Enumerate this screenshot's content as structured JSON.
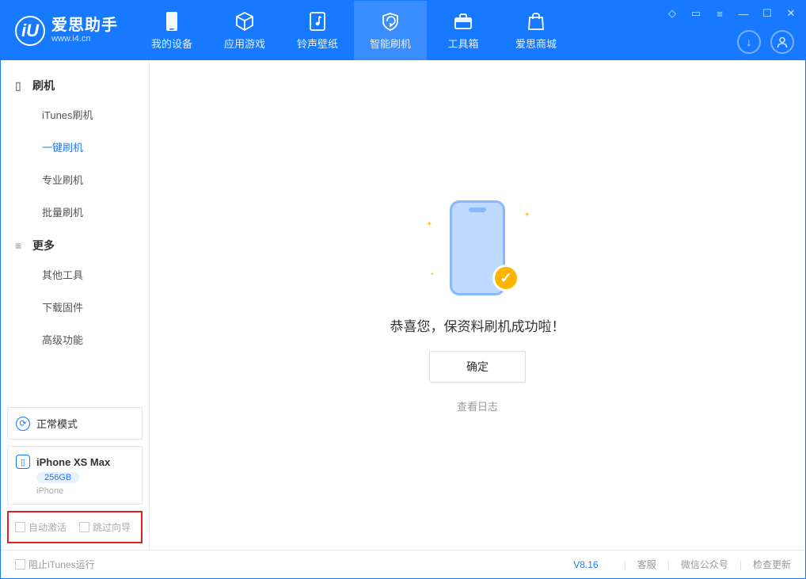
{
  "app": {
    "name": "爱思助手",
    "url": "www.i4.cn",
    "logo_letter": "iU"
  },
  "tabs": [
    {
      "label": "我的设备",
      "icon": "phone"
    },
    {
      "label": "应用游戏",
      "icon": "cube"
    },
    {
      "label": "铃声壁纸",
      "icon": "music"
    },
    {
      "label": "智能刷机",
      "icon": "shield",
      "active": true
    },
    {
      "label": "工具箱",
      "icon": "toolbox"
    },
    {
      "label": "爱思商城",
      "icon": "bag"
    }
  ],
  "sidebar": {
    "group1": {
      "title": "刷机",
      "items": [
        "iTunes刷机",
        "一键刷机",
        "专业刷机",
        "批量刷机"
      ],
      "active_index": 1
    },
    "group2": {
      "title": "更多",
      "items": [
        "其他工具",
        "下载固件",
        "高级功能"
      ]
    },
    "mode_card": {
      "label": "正常模式"
    },
    "device_card": {
      "name": "iPhone XS Max",
      "storage": "256GB",
      "type": "iPhone"
    },
    "redbox": {
      "opt1": "自动激活",
      "opt2": "跳过向导"
    }
  },
  "main": {
    "success_text": "恭喜您，保资料刷机成功啦！",
    "ok_button": "确定",
    "log_link": "查看日志"
  },
  "footer": {
    "stop_itunes": "阻止iTunes运行",
    "version": "V8.16",
    "links": [
      "客服",
      "微信公众号",
      "检查更新"
    ]
  }
}
